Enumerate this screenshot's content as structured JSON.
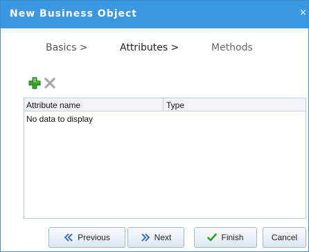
{
  "dialog": {
    "title": "New Business Object",
    "close_glyph": "×",
    "accent_color": "#3b97e0"
  },
  "wizard": {
    "steps": [
      {
        "label": "Basics >"
      },
      {
        "label": "Attributes >"
      },
      {
        "label": "Methods"
      }
    ]
  },
  "toolbar": {
    "add_icon": "green-plus-icon",
    "delete_icon": "gray-x-icon"
  },
  "grid": {
    "columns": [
      {
        "label": "Attribute name"
      },
      {
        "label": "Type"
      }
    ],
    "rows": [],
    "empty_text": "No data to display"
  },
  "buttons": {
    "previous": {
      "label": "Previous",
      "icon": "double-chevron-left-icon"
    },
    "next": {
      "label": "Next",
      "icon": "double-chevron-right-icon"
    },
    "finish": {
      "label": "Finish",
      "icon": "checkmark-icon"
    },
    "cancel": {
      "label": "Cancel"
    }
  }
}
